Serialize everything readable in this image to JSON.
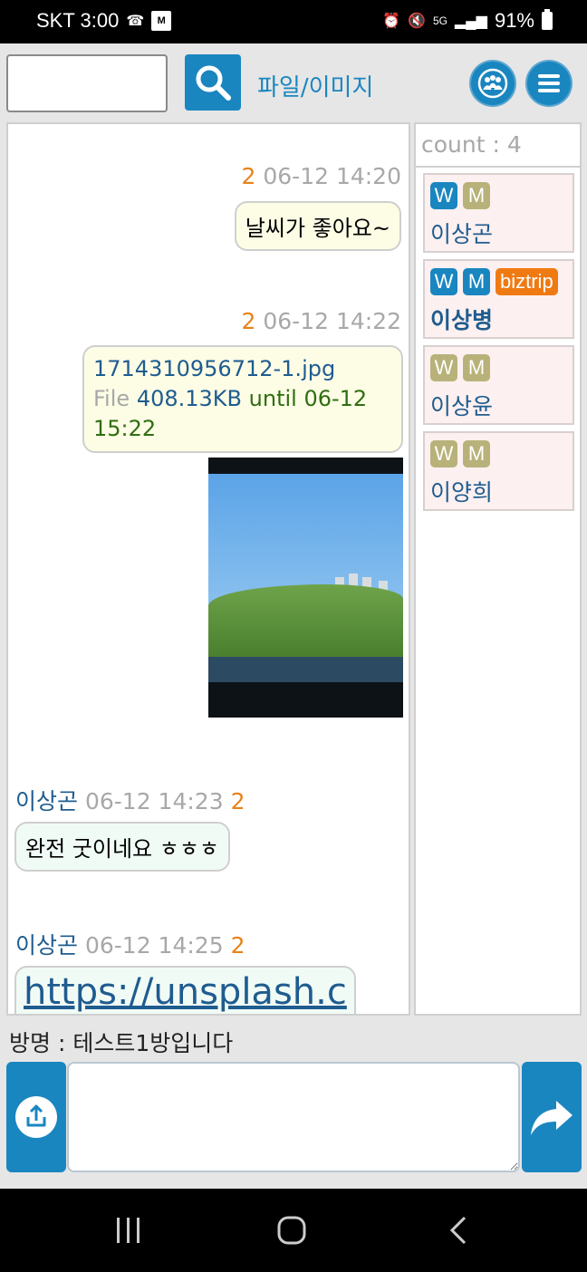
{
  "status_bar": {
    "carrier_time": "SKT 3:00",
    "mini_icon": "M",
    "network": "5G",
    "battery": "91%"
  },
  "toolbar": {
    "search_value": "",
    "file_image_link": "파일/이미지"
  },
  "messages": [
    {
      "side": "mine",
      "unread": "2",
      "time": "06-12 14:20",
      "text": "날씨가 좋아요~"
    },
    {
      "side": "mine",
      "unread": "2",
      "time": "06-12 14:22",
      "file": {
        "name": "1714310956712-1.jpg",
        "word": "File",
        "size": "408.13KB",
        "until": "until 06-12 15:22"
      }
    },
    {
      "side": "theirs",
      "sender": "이상곤",
      "time": "06-12 14:23",
      "unread": "2",
      "text": "완전 굿이네요 ㅎㅎㅎ"
    },
    {
      "side": "theirs",
      "sender": "이상곤",
      "time": "06-12 14:25",
      "unread": "2",
      "link": "https://unsplash.c"
    }
  ],
  "users": {
    "count_label": "count : 4",
    "list": [
      {
        "badges": [
          "W",
          "M"
        ],
        "name": "이상곤"
      },
      {
        "badges": [
          "W",
          "M",
          "biztrip"
        ],
        "name": "이상병"
      },
      {
        "badges": [
          "W",
          "M"
        ],
        "name": "이상윤"
      },
      {
        "badges": [
          "W",
          "M"
        ],
        "name": "이양희"
      }
    ]
  },
  "room": {
    "name": "방명 : 테스트1방입니다"
  },
  "composer": {
    "value": ""
  },
  "colors": {
    "accent": "#1a86c0",
    "unread": "#e8821a",
    "biztrip": "#f07a12",
    "badge_off": "#b8b27a"
  }
}
